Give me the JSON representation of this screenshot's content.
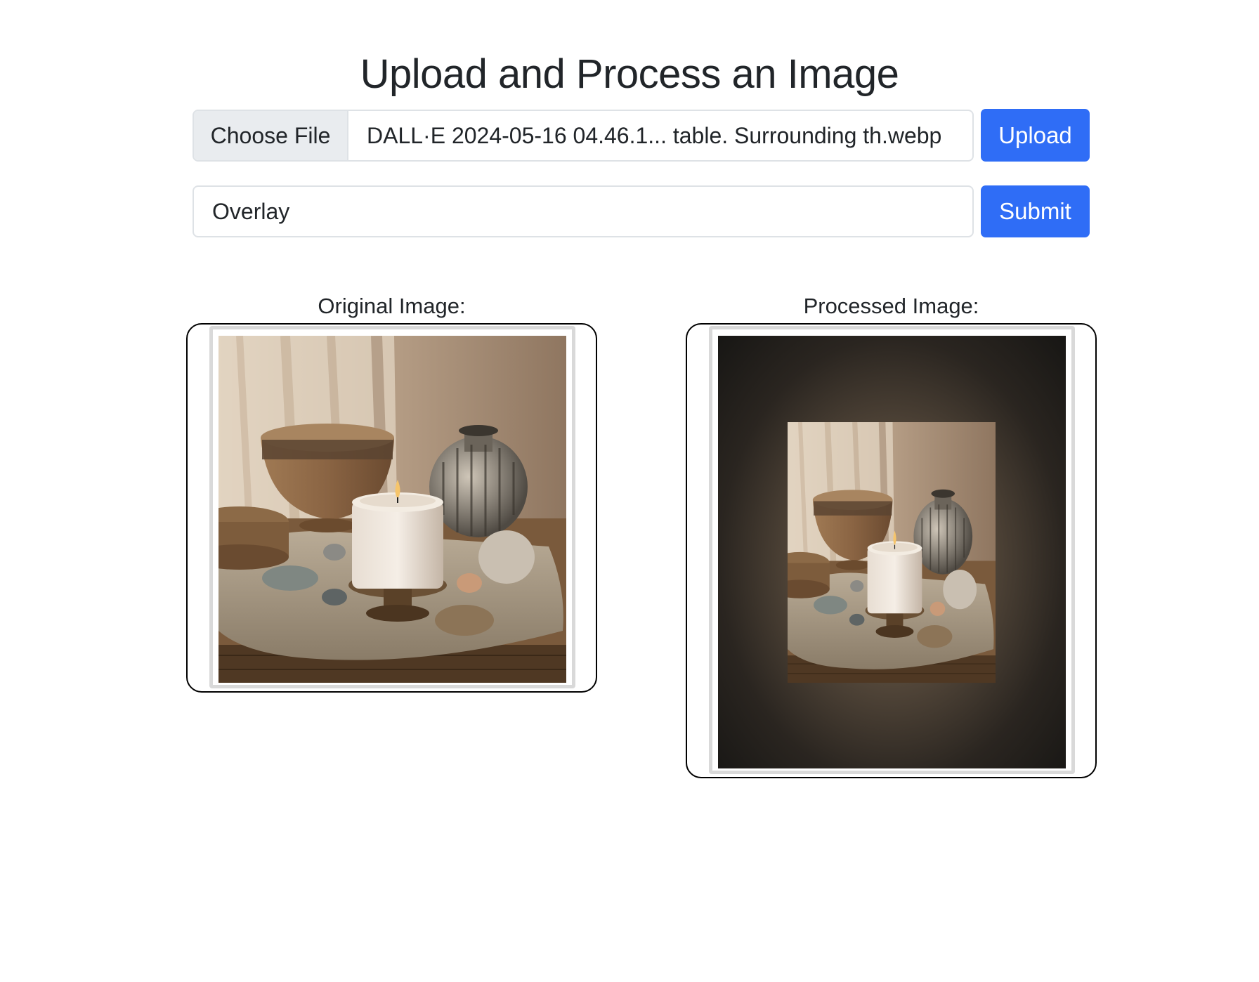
{
  "page": {
    "title": "Upload and Process an Image"
  },
  "upload_form": {
    "choose_file_label": "Choose File",
    "file_name": "DALL·E 2024-05-16 04.46.1... table. Surrounding th.webp",
    "upload_label": "Upload"
  },
  "process_form": {
    "filter_value": "Overlay",
    "submit_label": "Submit"
  },
  "results": {
    "original_caption": "Original Image:",
    "processed_caption": "Processed Image:"
  },
  "colors": {
    "primary": "#2f6df6",
    "border": "#dee2e6",
    "choose_bg": "#e9ecef"
  }
}
